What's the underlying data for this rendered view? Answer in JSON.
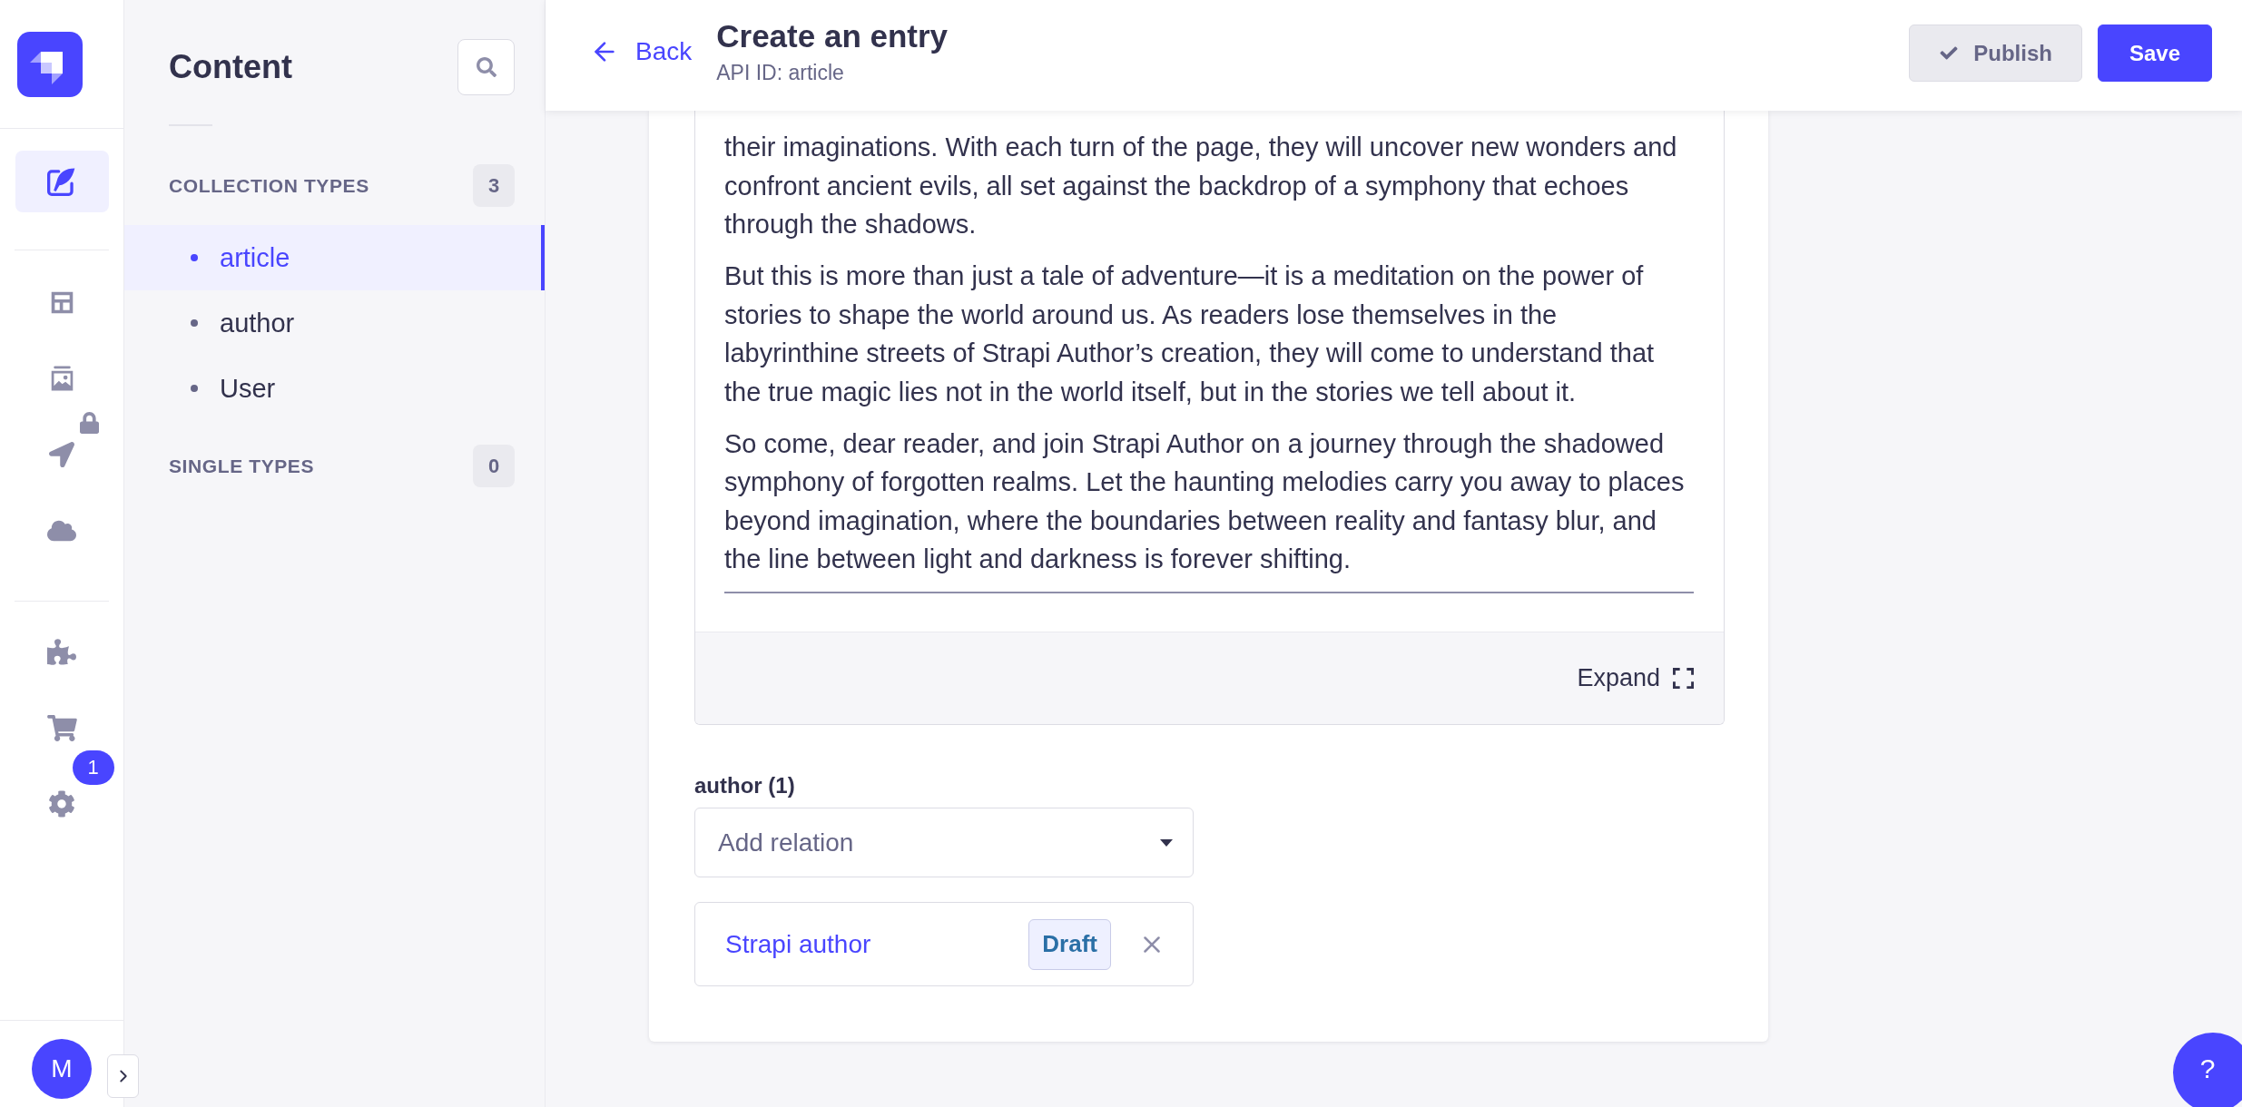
{
  "main_nav": {
    "groups": [
      [
        {
          "selected": true,
          "locked": false
        }
      ],
      [
        {
          "selected": false,
          "locked": false
        },
        {
          "selected": false,
          "locked": false
        },
        {
          "selected": false,
          "locked": true
        },
        {
          "selected": false,
          "locked": false
        }
      ],
      [
        {
          "selected": false,
          "locked": false
        },
        {
          "selected": false,
          "locked": false
        },
        {
          "selected": false,
          "locked": false,
          "badge": "1"
        }
      ]
    ],
    "avatar": "M"
  },
  "content_sidebar": {
    "title": "Content",
    "sections": [
      {
        "heading": "COLLECTION TYPES",
        "count": "3",
        "items": [
          {
            "label": "article",
            "selected": true
          },
          {
            "label": "author",
            "selected": false
          },
          {
            "label": "User",
            "selected": false
          }
        ]
      },
      {
        "heading": "SINGLE TYPES",
        "count": "0"
      }
    ]
  },
  "header": {
    "back": "Back",
    "title": "Create an entry",
    "subtitle": "API ID: article",
    "buttons": [
      {
        "kind": "publish",
        "label": "Publish",
        "disabled": true
      },
      {
        "kind": "save",
        "label": "Save",
        "disabled": false
      }
    ]
  },
  "editor": {
    "paragraphs": [
      "their imaginations. With each turn of the page, they will uncover new wonders and confront ancient evils, all set against the backdrop of a symphony that echoes through the shadows.",
      "But this is more than just a tale of adventure—it is a meditation on the power of stories to shape the world around us. As readers lose themselves in the labyrinthine streets of Strapi Author’s creation, they will come to understand that the true magic lies not in the world itself, but in the stories we tell about it.",
      "So come, dear reader, and join Strapi Author on a journey through the shadowed symphony of forgotten realms. Let the haunting melodies carry you away to places beyond imagination, where the boundaries between reality and fantasy blur, and the line between light and darkness is forever shifting."
    ],
    "expand": "Expand"
  },
  "relation": {
    "label": "author (1)",
    "placeholder": "Add relation",
    "items": [
      {
        "name": "Strapi author",
        "status": "Draft"
      }
    ]
  },
  "help": {
    "label": "?"
  }
}
